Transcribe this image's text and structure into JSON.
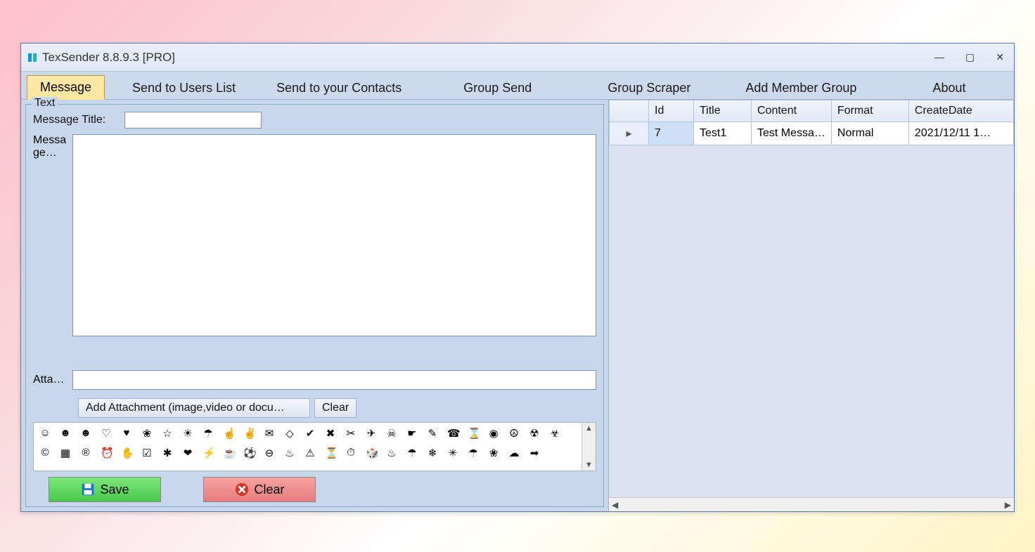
{
  "window": {
    "title": "TexSender 8.8.9.3 [PRO]"
  },
  "tabs": [
    {
      "label": "Message",
      "active": true
    },
    {
      "label": "Send to Users List"
    },
    {
      "label": "Send to your Contacts"
    },
    {
      "label": "Group Send"
    },
    {
      "label": "Group Scraper"
    },
    {
      "label": "Add Member Group"
    },
    {
      "label": "About"
    }
  ],
  "form": {
    "fieldset_title": "Text",
    "title_label": "Message Title:",
    "title_value": "",
    "body_label": "Message…",
    "body_value": "",
    "attach_label": "Atta…",
    "attach_value": "",
    "add_attachment_label": "Add Attachment  (image,video or docu…",
    "clear_small_label": "Clear",
    "save_label": "Save",
    "clear_label": "Clear"
  },
  "emojis_row1": [
    "☺",
    "☻",
    "☻",
    "♡",
    "♥",
    "❀",
    "☆",
    "☀",
    "☂",
    "☝",
    "✌",
    "✉",
    "◇",
    "✔",
    "✖",
    "✂",
    "✈",
    "☠",
    "☛",
    "✎",
    "☎",
    "⌛",
    "◉",
    "☮",
    "☢",
    "☣"
  ],
  "emojis_row2": [
    "©",
    "▦",
    "®",
    "⏰",
    "✋",
    "☑",
    "✱",
    "❤",
    "⚡",
    "☕",
    "⚽",
    "⊖",
    "♨",
    "⚠",
    "⏳",
    "⏱",
    "🎲",
    "♨",
    "☂",
    "❄",
    "✳",
    "☂",
    "❀",
    "☁",
    "➡"
  ],
  "grid": {
    "columns": [
      "",
      "Id",
      "Title",
      "Content",
      "Format",
      "CreateDate"
    ],
    "rows": [
      {
        "indicator": "▸",
        "Id": "7",
        "Title": "Test1",
        "Content": "Test Messa…",
        "Format": "Normal",
        "CreateDate": "2021/12/11 1…"
      }
    ]
  }
}
